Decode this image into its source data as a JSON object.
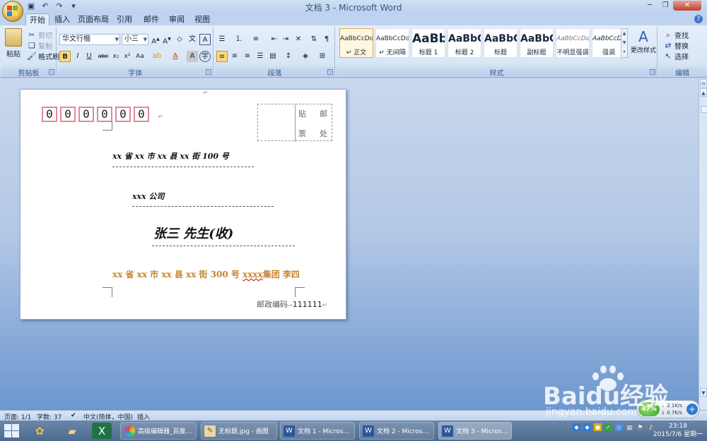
{
  "window": {
    "title": "文档 3 - Microsoft Word"
  },
  "tabs": [
    "开始",
    "插入",
    "页面布局",
    "引用",
    "邮件",
    "审阅",
    "视图"
  ],
  "ribbon": {
    "clipboard": {
      "label": "剪贴板",
      "paste": "粘贴",
      "cut": "剪切",
      "copy": "复制",
      "format_painter": "格式刷"
    },
    "font": {
      "label": "字体",
      "font_name": "华文行楷",
      "font_size": "小三"
    },
    "paragraph": {
      "label": "段落"
    },
    "styles": {
      "label": "样式",
      "items": [
        {
          "sample": "AaBbCcDd",
          "name": "↵ 正文"
        },
        {
          "sample": "AaBbCcDd",
          "name": "↵ 无间隔"
        },
        {
          "sample": "AaBb",
          "name": "标题 1"
        },
        {
          "sample": "AaBbC",
          "name": "标题 2"
        },
        {
          "sample": "AaBbC",
          "name": "标题"
        },
        {
          "sample": "AaBbC",
          "name": "副标题"
        },
        {
          "sample": "AaBbCcDd",
          "name": "不明显强调"
        },
        {
          "sample": "AaBbCcDd",
          "name": "强调"
        }
      ],
      "change_styles": "更改样式"
    },
    "editing": {
      "label": "编辑",
      "find": "查找",
      "replace": "替换",
      "select": "选择"
    }
  },
  "document": {
    "zip_digits": [
      "0",
      "0",
      "0",
      "0",
      "0",
      "0"
    ],
    "stamp": {
      "c1": "贴",
      "c2": "邮",
      "c3": "票",
      "c4": "处"
    },
    "recipient_address": "xx 省 xx 市 xx 县 xx 街 100 号",
    "recipient_company": "xxx 公司",
    "recipient_name": "张三 先生(收)",
    "sender_prefix": "xx 省 xx 市 xx 县 xx 街 300 号",
    "sender_company_sq": "xxxx",
    "sender_rest": "集团 李四",
    "postal_label": "邮政编码",
    "postal_code": "111111",
    "para_mark": "↵"
  },
  "statusbar": {
    "page": "页面: 1/1",
    "words": "字数: 37",
    "language": "中文(简体，中国)",
    "mode": "插入"
  },
  "taskbar": {
    "items": [
      "高级编辑器_百度…",
      "无标题.jpg - 画图",
      "文档 1 - Micros…",
      "文档 2 - Micros…",
      "文档 3 - Micros…"
    ],
    "time": "23:18",
    "date": "2015/7/6 星期一"
  },
  "net_widget": {
    "percent": "47%",
    "up": "2.1K/s",
    "down": "0.7K/s"
  },
  "watermark": {
    "brand": "Baidu经验",
    "url": "jingyan.baidu.com"
  },
  "colors": {
    "zip_box_border": "#e08a97",
    "sender_text": "#c7832a",
    "ribbon_bg": "#dbe7f6"
  }
}
